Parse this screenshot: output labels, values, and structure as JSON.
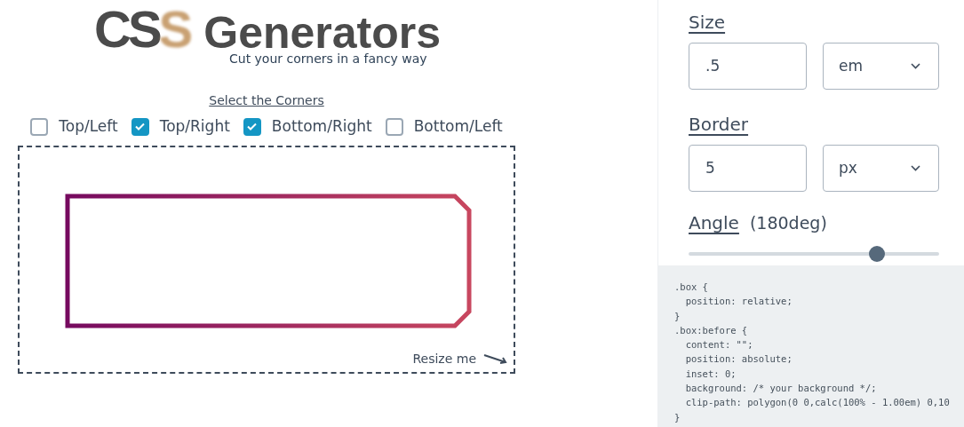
{
  "logo": {
    "letters": "CS",
    "accent_letter": "S",
    "word": "Generators",
    "tagline": "Cut your corners in a fancy way"
  },
  "corners": {
    "title": "Select the Corners",
    "options": [
      {
        "label": "Top/Left",
        "checked": false
      },
      {
        "label": "Top/Right",
        "checked": true
      },
      {
        "label": "Bottom/Right",
        "checked": true
      },
      {
        "label": "Bottom/Left",
        "checked": false
      }
    ]
  },
  "preview": {
    "resize_hint": "Resize me"
  },
  "settings": {
    "size": {
      "label": "Size",
      "value": ".5",
      "unit": "em"
    },
    "border": {
      "label": "Border",
      "value": "5",
      "unit": "px"
    },
    "angle": {
      "label": "Angle",
      "reading": "(180deg)",
      "level": 0.77
    }
  },
  "code": [
    ".box {",
    "  position: relative;",
    "}",
    ".box:before {",
    "  content: \"\";",
    "  position: absolute;",
    "  inset: 0;",
    "  background: /* your background */;",
    "  clip-path: polygon(0 0,calc(100% - 1.00em) 0,10",
    "}"
  ]
}
